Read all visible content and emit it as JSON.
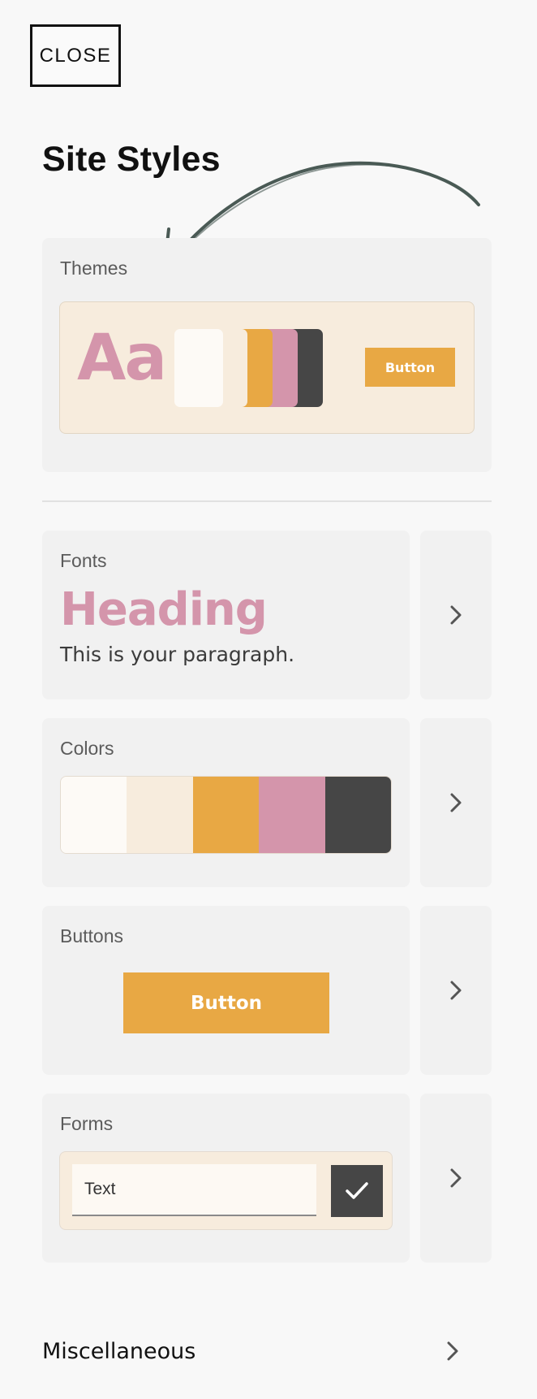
{
  "header": {
    "close_label": "CLOSE",
    "title": "Site Styles"
  },
  "themes": {
    "label": "Themes",
    "sample_text": "Aa",
    "button_label": "Button",
    "swatches": [
      "#fdfaf6",
      "#f7ecdd",
      "#e8a844",
      "#d495ab",
      "#464646"
    ]
  },
  "fonts": {
    "label": "Fonts",
    "heading_sample": "Heading",
    "paragraph_sample": "This is your paragraph."
  },
  "colors": {
    "label": "Colors",
    "palette": [
      "#fdfaf6",
      "#f7ecdd",
      "#e8a844",
      "#d495ab",
      "#464646"
    ]
  },
  "buttons": {
    "label": "Buttons",
    "sample_label": "Button"
  },
  "forms": {
    "label": "Forms",
    "input_sample": "Text"
  },
  "misc": {
    "label": "Miscellaneous"
  },
  "colors_theme": {
    "accent_orange": "#e8a844",
    "accent_pink": "#d495ab",
    "dark": "#464646",
    "card_bg": "#f1f1f1",
    "arrow": "#4a5a55"
  }
}
